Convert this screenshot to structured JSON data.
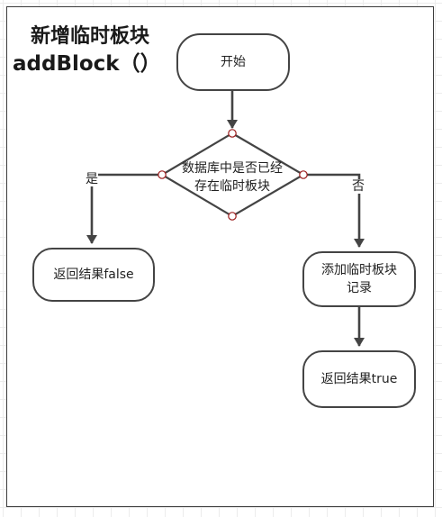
{
  "title": {
    "line1": "新增临时板块",
    "line2": "addBlock（）"
  },
  "nodes": {
    "start": "开始",
    "decision_line1": "数据库中是否已经",
    "decision_line2": "存在临时板块",
    "return_false": "返回结果false",
    "add_record_line1": "添加临时板块",
    "add_record_line2": "记录",
    "return_true": "返回结果true"
  },
  "edges": {
    "yes_label": "是",
    "no_label": "否"
  },
  "colors": {
    "stroke": "#444444",
    "connection_point": "#9b1b1b",
    "grid": "#ececec"
  }
}
